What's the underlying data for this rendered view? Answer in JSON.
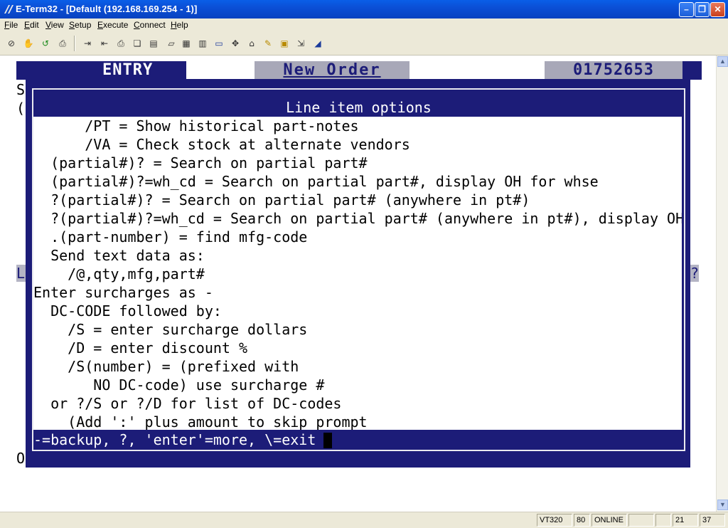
{
  "window": {
    "title": "E-Term32 - [Default (192.168.169.254 - 1)]",
    "min_glyph": "–",
    "max_glyph": "❐",
    "close_glyph": "✕",
    "icon": "eterm-app-icon"
  },
  "menu": [
    "File",
    "Edit",
    "View",
    "Setup",
    "Execute",
    "Connect",
    "Help"
  ],
  "toolbar": {
    "icons": [
      {
        "name": "disconnect-icon",
        "glyph": "⊘"
      },
      {
        "name": "hand-icon",
        "glyph": "✋"
      },
      {
        "name": "connect-icon",
        "glyph": "↺"
      },
      {
        "name": "print-setup-icon",
        "glyph": "⎙"
      },
      {
        "name": "send-file-icon",
        "glyph": "⇥"
      },
      {
        "name": "receive-file-icon",
        "glyph": "⇤"
      },
      {
        "name": "print-icon",
        "glyph": "⎙"
      },
      {
        "name": "copy-icon",
        "glyph": "❏"
      },
      {
        "name": "paste-icon",
        "glyph": "▤"
      },
      {
        "name": "clear-icon",
        "glyph": "▱"
      },
      {
        "name": "keypad-icon",
        "glyph": "▦"
      },
      {
        "name": "columns-icon",
        "glyph": "▥"
      },
      {
        "name": "display-132-icon",
        "glyph": "▭"
      },
      {
        "name": "move-icon",
        "glyph": "✥"
      },
      {
        "name": "network-icon",
        "glyph": "⌂"
      },
      {
        "name": "macro-icon",
        "glyph": "✎"
      },
      {
        "name": "script-icon",
        "glyph": "▣"
      },
      {
        "name": "exit-icon",
        "glyph": "⇲"
      },
      {
        "name": "edit-icon",
        "glyph": "◢"
      }
    ]
  },
  "screen": {
    "header_left": "ENTRY",
    "header_mid": "New Order",
    "header_right": "01752653",
    "bg_chars": {
      "s": "S",
      "paren": "(",
      "l": "L",
      "q": "?",
      "o": "O"
    }
  },
  "dialog": {
    "title": "Line item options",
    "lines": [
      "      /PT = Show historical part-notes",
      "      /VA = Check stock at alternate vendors",
      "  (partial#)? = Search on partial part#",
      "  (partial#)?=wh_cd = Search on partial part#, display OH for whse",
      "  ?(partial#)? = Search on partial part# (anywhere in pt#)",
      "  ?(partial#)?=wh_cd = Search on partial part# (anywhere in pt#), display OH",
      "  .(part-number) = find mfg-code",
      "  Send text data as:",
      "    /@,qty,mfg,part#",
      "Enter surcharges as -",
      "  DC-CODE followed by:",
      "    /S = enter surcharge dollars",
      "    /D = enter discount %",
      "    /S(number) = (prefixed with",
      "       NO DC-code) use surcharge #",
      "  or ?/S or ?/D for list of DC-codes",
      "    (Add ':' plus amount to skip prompt"
    ],
    "footer": "-=backup, ?, 'enter'=more, \\=exit "
  },
  "scrollbar": {
    "up": "▲",
    "down": "▼"
  },
  "status": {
    "terminal_type": "VT320",
    "columns": "80",
    "connection": "ONLINE",
    "blank1": "",
    "blank2": "",
    "row": "21",
    "col": "37"
  }
}
